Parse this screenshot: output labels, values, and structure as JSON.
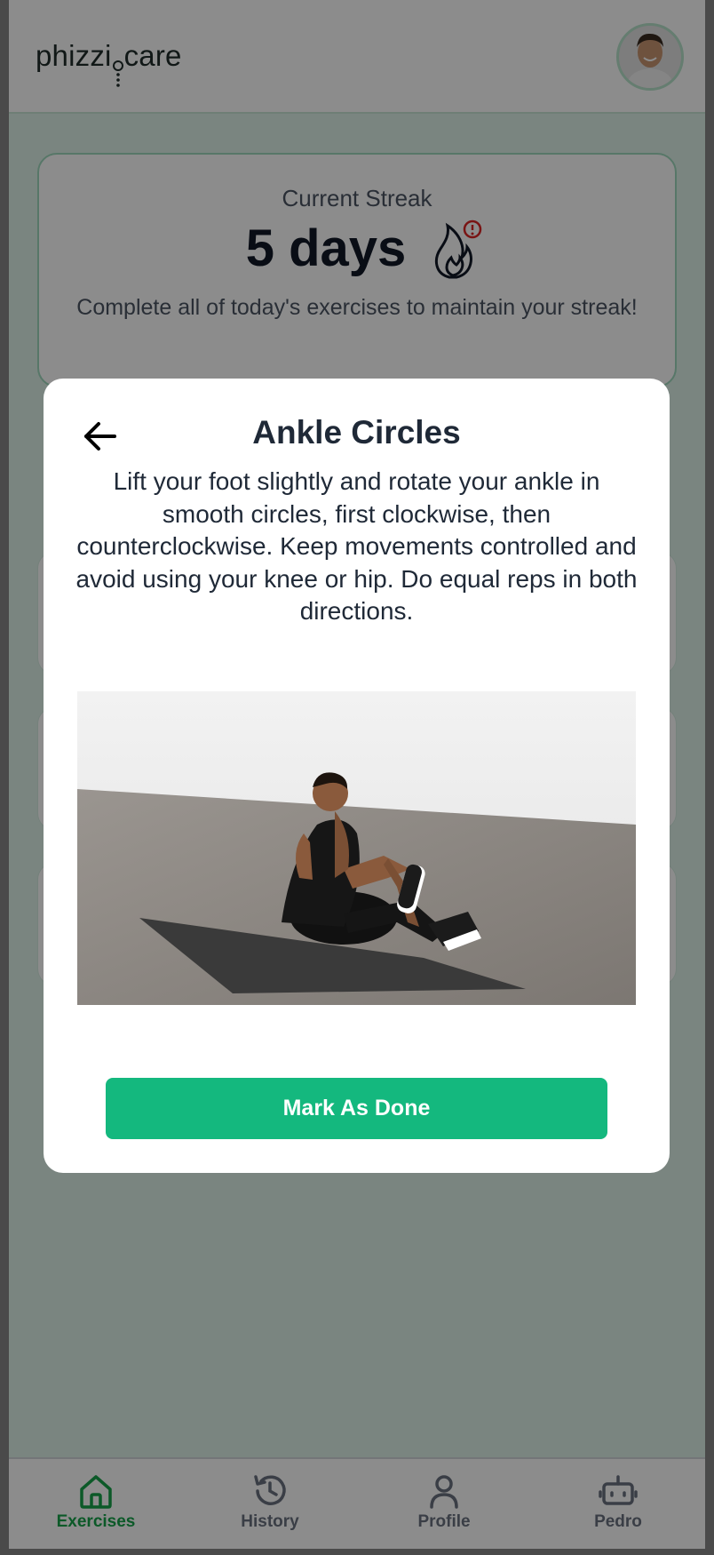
{
  "header": {
    "logo_text": "phizzicare",
    "logo_left": "phizzi",
    "logo_right": "care",
    "avatar_alt": "user avatar"
  },
  "streak": {
    "label": "Current Streak",
    "value": "5 days",
    "message": "Complete all of today's exercises to maintain your streak!",
    "alert_icon": "alert-circle-icon",
    "flame_icon": "flame-icon"
  },
  "modal": {
    "title": "Ankle Circles",
    "description": "Lift your foot slightly and rotate your ankle in smooth circles, first clockwise, then counterclockwise. Keep movements controlled and avoid using your knee or hip. Do equal reps in both directions.",
    "button_label": "Mark As Done",
    "back_icon": "arrow-left-icon"
  },
  "nav": {
    "items": [
      {
        "label": "Exercises",
        "icon": "home-icon",
        "active": true
      },
      {
        "label": "History",
        "icon": "history-icon",
        "active": false
      },
      {
        "label": "Profile",
        "icon": "user-icon",
        "active": false
      },
      {
        "label": "Pedro",
        "icon": "robot-icon",
        "active": false
      }
    ]
  },
  "colors": {
    "accent": "#14b87e",
    "active_nav": "#16a34a",
    "alert": "#dc2626",
    "page_bg": "#dff3e9"
  }
}
